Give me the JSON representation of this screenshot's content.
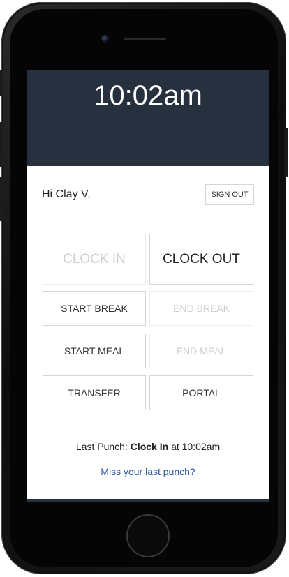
{
  "header": {
    "time": "10:02am"
  },
  "greeting": {
    "text": "Hi Clay V,"
  },
  "signout": {
    "label": "SIGN OUT"
  },
  "buttons": {
    "clock_in": "CLOCK IN",
    "clock_out": "CLOCK OUT",
    "start_break": "START BREAK",
    "end_break": "END BREAK",
    "start_meal": "START MEAL",
    "end_meal": "END MEAL",
    "transfer": "TRANSFER",
    "portal": "PORTAL"
  },
  "last_punch": {
    "prefix": "Last Punch:",
    "type": "Clock In",
    "suffix": "at 10:02am"
  },
  "miss_punch_link": "Miss your last punch?",
  "colors": {
    "header_bg": "#27303f",
    "link": "#2a5aa0",
    "disabled_text": "#cfcfcf"
  }
}
